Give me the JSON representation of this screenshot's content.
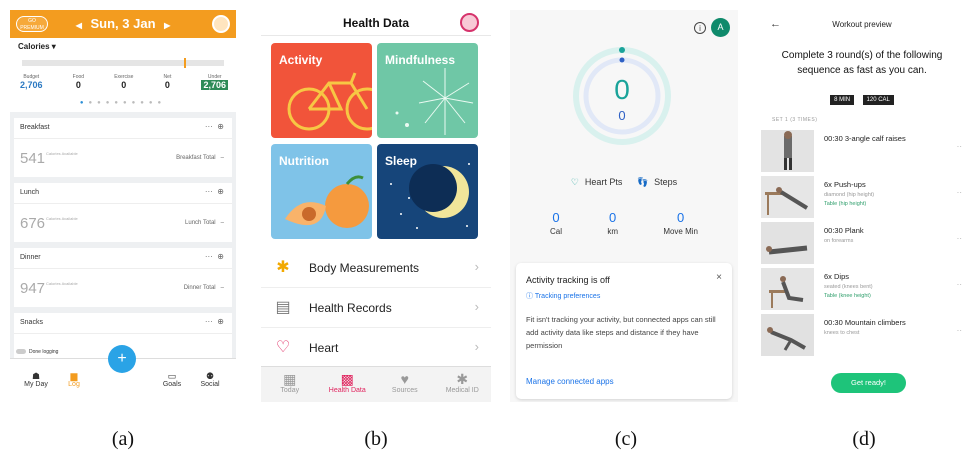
{
  "captions": [
    "(a)",
    "(b)",
    "(c)",
    "(d)"
  ],
  "app_a": {
    "premium_badge": "GO PREMIUM",
    "date": "Sun, 3 Jan",
    "calories_label": "Calories ▾",
    "summary": [
      {
        "label": "Budget",
        "value": "2,706"
      },
      {
        "label": "Food",
        "value": "0"
      },
      {
        "label": "Exercise",
        "value": "0"
      },
      {
        "label": "Net",
        "value": "0"
      },
      {
        "label": "Under",
        "value": "2,706"
      }
    ],
    "meals": [
      {
        "name": "Breakfast",
        "calories": "541",
        "unit": "Calories Available",
        "total": "Breakfast Total",
        "dash": "–"
      },
      {
        "name": "Lunch",
        "calories": "676",
        "unit": "Calories Available",
        "total": "Lunch Total",
        "dash": "–"
      },
      {
        "name": "Dinner",
        "calories": "947",
        "unit": "Calories Available",
        "total": "Dinner Total",
        "dash": "–"
      },
      {
        "name": "Snacks",
        "calories": "",
        "unit": "",
        "total": "",
        "dash": ""
      }
    ],
    "done_logging": "Done logging",
    "fab": "+",
    "nav": [
      {
        "label": "My Day",
        "icon": "☗"
      },
      {
        "label": "Log",
        "icon": "▆"
      },
      {
        "label": "Goals",
        "icon": "▭"
      },
      {
        "label": "Social",
        "icon": "⚉"
      }
    ],
    "colors": {
      "accent": "#f39c1f",
      "blue": "#2aa3e6",
      "under": "#2e8b57"
    }
  },
  "app_b": {
    "title": "Health Data",
    "tiles": [
      {
        "label": "Activity",
        "color": "#f1543a"
      },
      {
        "label": "Mindfulness",
        "color": "#6fc7a6"
      },
      {
        "label": "Nutrition",
        "color": "#7fc3e8"
      },
      {
        "label": "Sleep",
        "color": "#16457a"
      }
    ],
    "list": [
      {
        "label": "Body Measurements",
        "icon": "✱"
      },
      {
        "label": "Health Records",
        "icon": "▤"
      },
      {
        "label": "Heart",
        "icon": "♡"
      }
    ],
    "tabs": [
      {
        "label": "Today",
        "icon": "▦"
      },
      {
        "label": "Health Data",
        "icon": "▩"
      },
      {
        "label": "Sources",
        "icon": "♥"
      },
      {
        "label": "Medical ID",
        "icon": "✱"
      }
    ],
    "colors": {
      "accent": "#e0245e"
    }
  },
  "app_c": {
    "info_icon": "i",
    "avatar_letter": "A",
    "ring_primary": "0",
    "ring_secondary": "0",
    "legend_heart": "Heart Pts",
    "legend_steps": "Steps",
    "stats": [
      {
        "value": "0",
        "label": "Cal"
      },
      {
        "value": "0",
        "label": "km"
      },
      {
        "value": "0",
        "label": "Move Min"
      }
    ],
    "card": {
      "title": "Activity tracking is off",
      "close": "×",
      "preferences": "Tracking preferences",
      "body": "Fit isn't tracking your activity, but connected apps can still add activity data like steps and distance if they have permission",
      "link": "Manage connected apps"
    },
    "colors": {
      "teal": "#1aa39a",
      "blue": "#1a73e8"
    }
  },
  "app_d": {
    "back": "←",
    "title": "Workout preview",
    "heading": "Complete 3 round(s) of the following sequence as fast as you can.",
    "badges": [
      "8 MIN",
      "120 CAL"
    ],
    "set_label": "SET 1 (3 TIMES)",
    "exercises": [
      {
        "name": "00:30 3-angle calf raises",
        "sub": "",
        "sub2": ""
      },
      {
        "name": "6x Push-ups",
        "sub": "diamond (hip height)",
        "sub2": "Table (hip height)"
      },
      {
        "name": "00:30 Plank",
        "sub": "on forearms",
        "sub2": ""
      },
      {
        "name": "6x Dips",
        "sub": "seated (knees bent)",
        "sub2": "Table (knee height)"
      },
      {
        "name": "00:30 Mountain climbers",
        "sub": "knees to chest",
        "sub2": ""
      }
    ],
    "more": "··",
    "cta": "Get ready!",
    "colors": {
      "cta": "#1ec47a"
    }
  }
}
